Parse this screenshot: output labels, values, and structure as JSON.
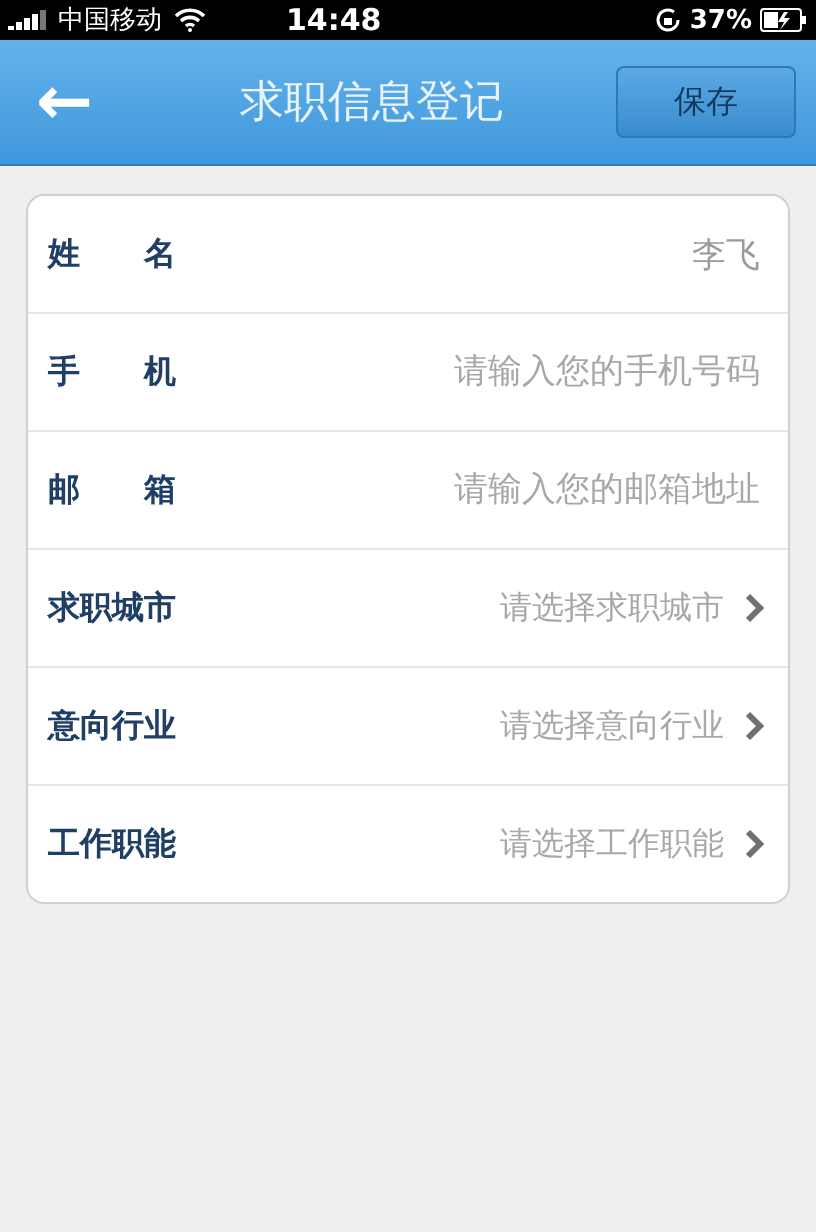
{
  "status_bar": {
    "carrier": "中国移动",
    "time": "14:48",
    "battery": "37%"
  },
  "header": {
    "back_icon": "←",
    "title": "求职信息登记",
    "save_button": "保存"
  },
  "form": {
    "rows": [
      {
        "kind": "input",
        "label": "姓　　名",
        "value": "李飞"
      },
      {
        "kind": "input",
        "label": "手　　机",
        "placeholder": "请输入您的手机号码"
      },
      {
        "kind": "input",
        "label": "邮　　箱",
        "placeholder": "请输入您的邮箱地址"
      },
      {
        "kind": "select",
        "label": "求职城市",
        "placeholder": "请选择求职城市"
      },
      {
        "kind": "select",
        "label": "意向行业",
        "placeholder": "请选择意向行业"
      },
      {
        "kind": "select",
        "label": "工作职能",
        "placeholder": "请选择工作职能"
      }
    ]
  }
}
